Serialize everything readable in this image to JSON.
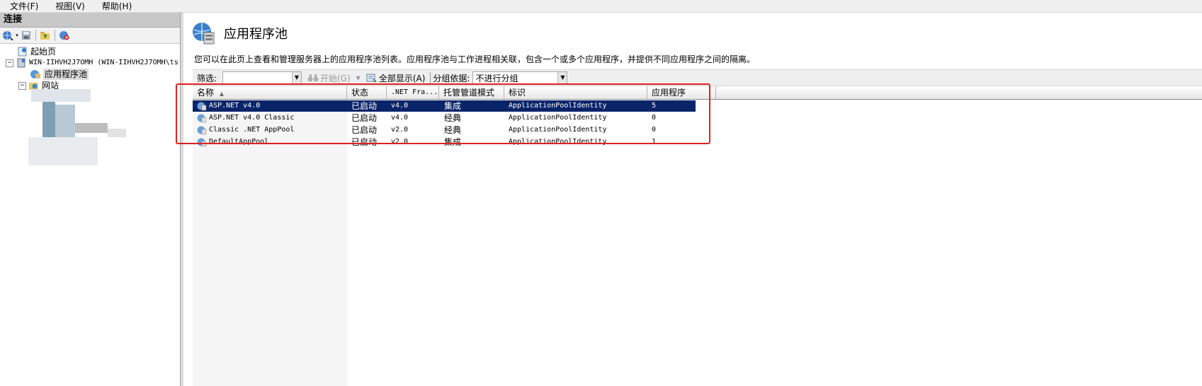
{
  "menu": {
    "file": "文件(F)",
    "view": "视图(V)",
    "help": "帮助(H)"
  },
  "connections": {
    "title": "连接",
    "tree": {
      "start_page": "起始页",
      "server": "WIN-IIHVH2J7OMH (WIN-IIHVH2J7OMH\\ts",
      "app_pools": "应用程序池",
      "sites": "网站"
    }
  },
  "main": {
    "title": "应用程序池",
    "description": "您可以在此页上查看和管理服务器上的应用程序池列表。应用程序池与工作进程相关联，包含一个或多个应用程序，并提供不同应用程序之间的隔离。",
    "filter": {
      "label": "筛选:",
      "value": "",
      "start_label": "开始(G)",
      "show_all_label": "全部显示(A)",
      "group_by_label": "分组依据:",
      "group_by_value": "不进行分组"
    },
    "columns": {
      "name": "名称",
      "status": "状态",
      "framework": ".NET Fra...",
      "pipeline": "托管管道模式",
      "identity": "标识",
      "apps": "应用程序"
    },
    "pools": [
      {
        "name": "ASP.NET v4.0",
        "status": "已启动",
        "framework": "v4.0",
        "pipeline": "集成",
        "identity": "ApplicationPoolIdentity",
        "apps": "5"
      },
      {
        "name": "ASP.NET v4.0 Classic",
        "status": "已启动",
        "framework": "v4.0",
        "pipeline": "经典",
        "identity": "ApplicationPoolIdentity",
        "apps": "0"
      },
      {
        "name": "Classic .NET AppPool",
        "status": "已启动",
        "framework": "v2.0",
        "pipeline": "经典",
        "identity": "ApplicationPoolIdentity",
        "apps": "0"
      },
      {
        "name": "DefaultAppPool",
        "status": "已启动",
        "framework": "v2.0",
        "pipeline": "集成",
        "identity": "ApplicationPoolIdentity",
        "apps": "1"
      }
    ]
  },
  "colors": {
    "selection": "#0a246a",
    "highlight_box": "#e02020"
  }
}
